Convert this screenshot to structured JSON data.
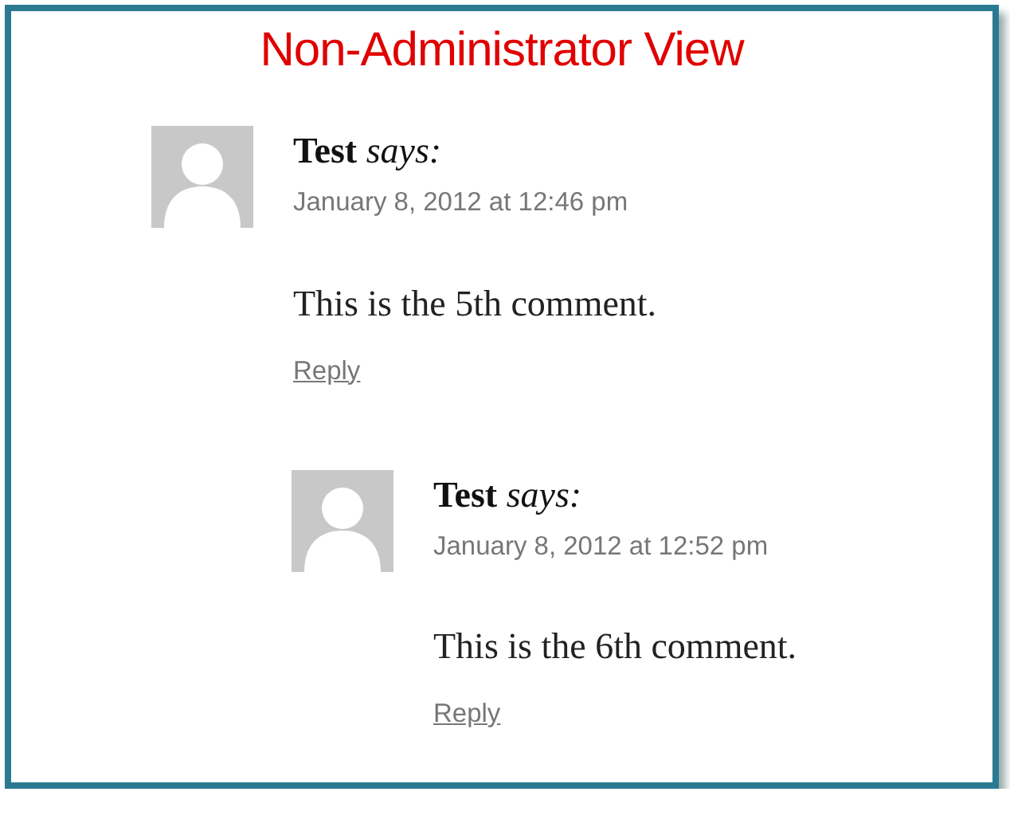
{
  "title": "Non-Administrator View",
  "comments": [
    {
      "author": "Test",
      "says": "says:",
      "date": "January 8, 2012 at 12:46 pm",
      "text": "This is the 5th comment.",
      "reply": "Reply",
      "children": [
        {
          "author": "Test",
          "says": "says:",
          "date": "January 8, 2012 at 12:52 pm",
          "text": "This is the 6th comment.",
          "reply": "Reply"
        }
      ]
    }
  ]
}
